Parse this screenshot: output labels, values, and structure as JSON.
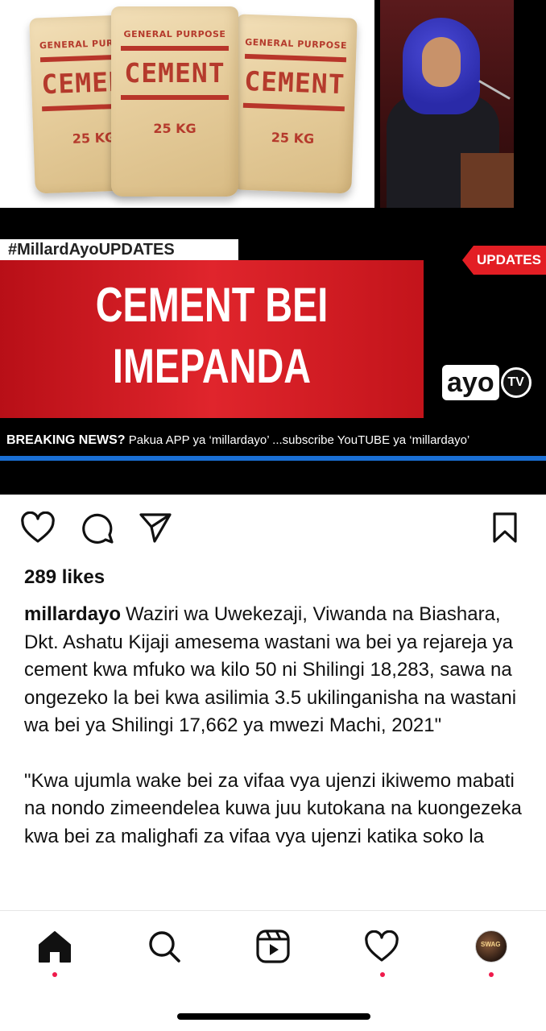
{
  "post_image": {
    "bag_top_label": "GENERAL PURPOSE",
    "bag_word": "CEMENT",
    "bag_weight": "25 KG",
    "hashtag": "#MillardAyoUPDATES",
    "updates_tag": "UPDATES",
    "headline_line1": "CEMENT BEI",
    "headline_line2": "IMEPANDA",
    "logo_word": "ayo",
    "logo_tv": "TV",
    "ticker_bold": "BREAKING NEWS?",
    "ticker_text": " Pakua APP ya ‘millardayo’ ...subscribe YouTUBE ya ‘millardayo’"
  },
  "actions": {
    "like_icon": "heart-icon",
    "comment_icon": "comment-icon",
    "share_icon": "send-icon",
    "save_icon": "bookmark-icon"
  },
  "likes": "289 likes",
  "caption": {
    "username": "millardayo",
    "paragraph1": "Waziri wa Uwekezaji, Viwanda na Biashara, Dkt. Ashatu Kijaji amesema wastani wa bei ya rejareja ya cement kwa mfuko wa kilo 50 ni Shilingi 18,283, sawa na ongezeko la bei kwa asilimia 3.5 ukilinganisha na wastani wa bei ya Shilingi 17,662 ya mwezi Machi, 2021\"",
    "paragraph2": "\"Kwa ujumla wake bei za vifaa vya ujenzi ikiwemo mabati na nondo zimeendelea kuwa juu kutokana na kuongezeka kwa bei za malighafi za vifaa vya ujenzi katika soko la"
  },
  "bottom_nav": {
    "items": [
      "home-icon",
      "search-icon",
      "reels-icon",
      "activity-heart-icon",
      "profile-avatar"
    ],
    "avatar_text": "SWAG",
    "accent": "#ef1a4b"
  }
}
